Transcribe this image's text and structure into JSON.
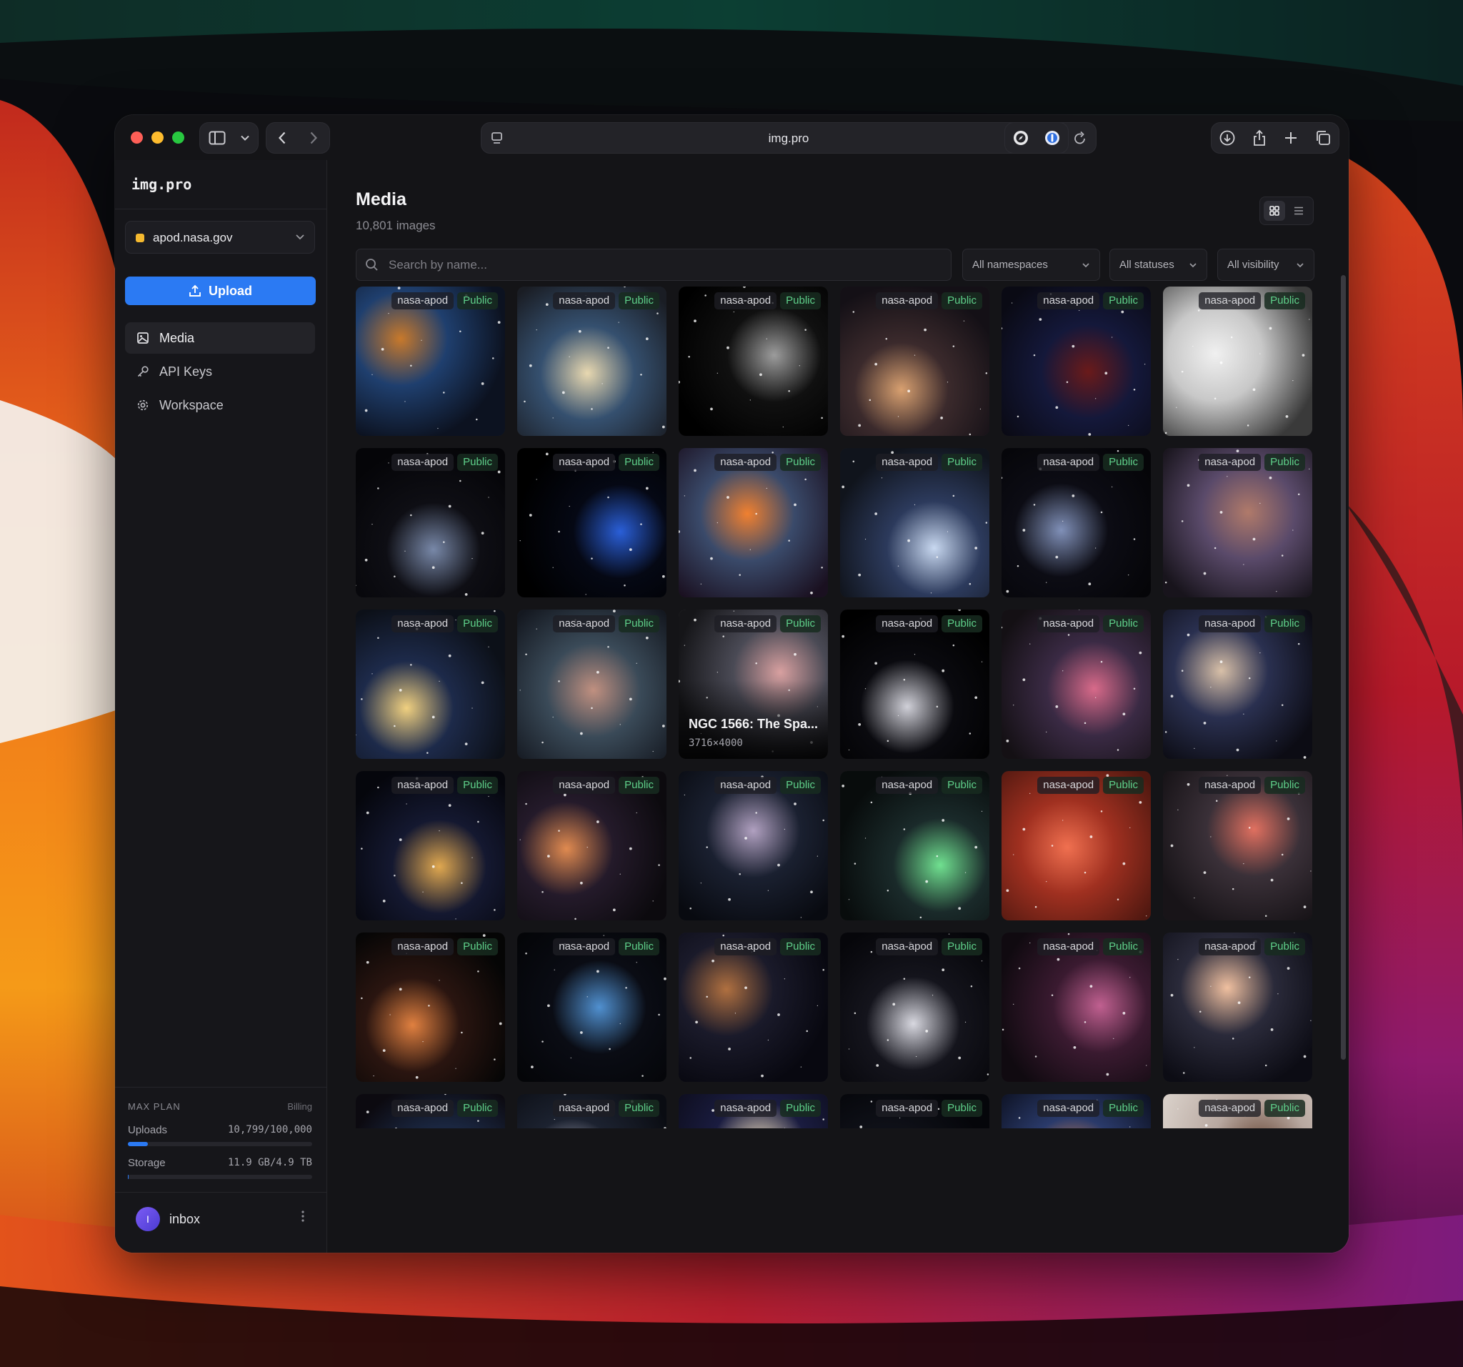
{
  "browser": {
    "url": "img.pro"
  },
  "sidebar": {
    "brand": "img.pro",
    "workspace": "apod.nasa.gov",
    "upload_label": "Upload",
    "nav": [
      {
        "label": "Media",
        "icon": "image-icon",
        "active": true
      },
      {
        "label": "API Keys",
        "icon": "key-icon",
        "active": false
      },
      {
        "label": "Workspace",
        "icon": "gear-icon",
        "active": false
      }
    ],
    "plan": {
      "name": "MAX PLAN",
      "billing_label": "Billing",
      "uploads_label": "Uploads",
      "uploads_value": "10,799/100,000",
      "uploads_fraction": 0.108,
      "storage_label": "Storage",
      "storage_value": "11.9 GB/4.9 TB",
      "storage_fraction": 0.002
    },
    "user": {
      "initial": "I",
      "name": "inbox"
    }
  },
  "main": {
    "title": "Media",
    "count": "10,801 images",
    "search_placeholder": "Search by name...",
    "filters": [
      "All namespaces",
      "All statuses",
      "All visibility"
    ],
    "hover_caption": "NGC 1566: The Spa...",
    "hover_dims": "3716×4000",
    "tiles": [
      {
        "ns": "nasa-apod",
        "vis": "Public"
      },
      {
        "ns": "nasa-apod",
        "vis": "Public"
      },
      {
        "ns": "nasa-apod",
        "vis": "Public"
      },
      {
        "ns": "nasa-apod",
        "vis": "Public"
      },
      {
        "ns": "nasa-apod",
        "vis": "Public"
      },
      {
        "ns": "nasa-apod",
        "vis": "Public"
      },
      {
        "ns": "nasa-apod",
        "vis": "Public"
      },
      {
        "ns": "nasa-apod",
        "vis": "Public"
      },
      {
        "ns": "nasa-apod",
        "vis": "Public"
      },
      {
        "ns": "nasa-apod",
        "vis": "Public"
      },
      {
        "ns": "nasa-apod",
        "vis": "Public"
      },
      {
        "ns": "nasa-apod",
        "vis": "Public"
      },
      {
        "ns": "nasa-apod",
        "vis": "Public"
      },
      {
        "ns": "nasa-apod",
        "vis": "Public"
      },
      {
        "ns": "nasa-apod",
        "vis": "Public"
      },
      {
        "ns": "nasa-apod",
        "vis": "Public"
      },
      {
        "ns": "nasa-apod",
        "vis": "Public"
      },
      {
        "ns": "nasa-apod",
        "vis": "Public"
      },
      {
        "ns": "nasa-apod",
        "vis": "Public"
      },
      {
        "ns": "nasa-apod",
        "vis": "Public"
      },
      {
        "ns": "nasa-apod",
        "vis": "Public"
      },
      {
        "ns": "nasa-apod",
        "vis": "Public"
      },
      {
        "ns": "nasa-apod",
        "vis": "Public"
      },
      {
        "ns": "nasa-apod",
        "vis": "Public"
      },
      {
        "ns": "nasa-apod",
        "vis": "Public"
      },
      {
        "ns": "nasa-apod",
        "vis": "Public"
      },
      {
        "ns": "nasa-apod",
        "vis": "Public"
      },
      {
        "ns": "nasa-apod",
        "vis": "Public"
      },
      {
        "ns": "nasa-apod",
        "vis": "Public"
      },
      {
        "ns": "nasa-apod",
        "vis": "Public"
      },
      {
        "ns": "nasa-apod",
        "vis": "Public"
      },
      {
        "ns": "nasa-apod",
        "vis": "Public"
      },
      {
        "ns": "nasa-apod",
        "vis": "Public"
      },
      {
        "ns": "nasa-apod",
        "vis": "Public"
      },
      {
        "ns": "nasa-apod",
        "vis": "Public"
      },
      {
        "ns": "nasa-apod",
        "vis": "Public"
      }
    ]
  },
  "colors": {
    "accent": "#2b7af3",
    "public_badge": "#5fd08a",
    "workspace_dot": "#f5b92f"
  }
}
